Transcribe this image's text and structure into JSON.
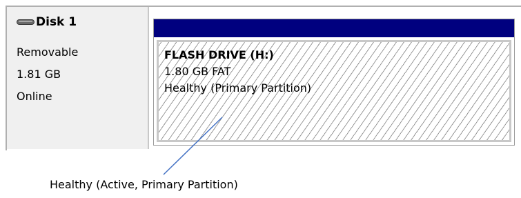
{
  "disk": {
    "name": "Disk 1",
    "type": "Removable",
    "size": "1.81 GB",
    "status": "Online",
    "icon": "removable-disk-icon"
  },
  "partition": {
    "name": "FLASH DRIVE  (H:)",
    "size_fs": "1.80 GB FAT",
    "health": "Healthy (Primary Partition)",
    "bar_color": "#00007f",
    "hatch_color": "#9a9a9a"
  },
  "callout": {
    "text": "Healthy (Active, Primary Partition)",
    "line_color": "#4472c4"
  }
}
